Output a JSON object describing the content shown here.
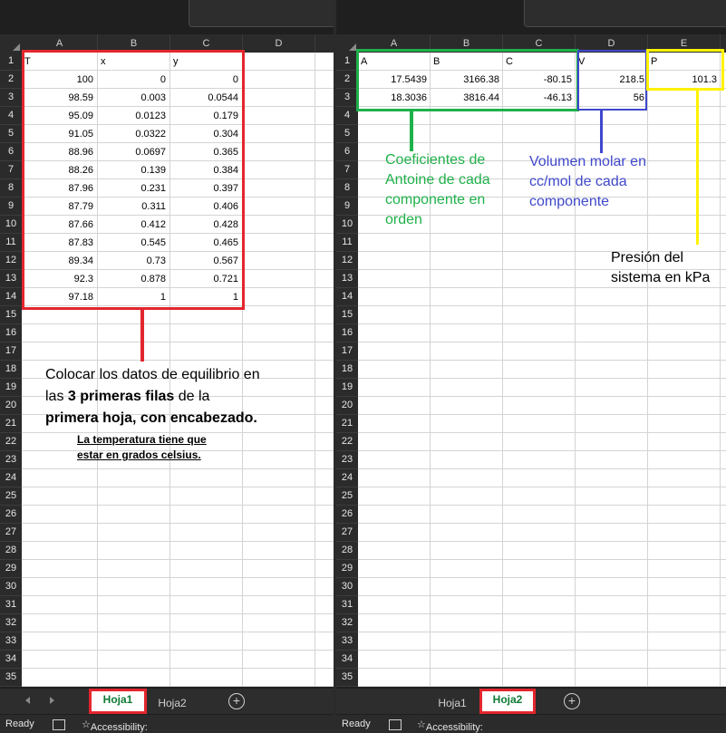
{
  "left": {
    "columns": [
      "A",
      "B",
      "C",
      "D"
    ],
    "rows": [
      "1",
      "2",
      "3",
      "4",
      "5",
      "6",
      "7",
      "8",
      "9",
      "10",
      "11",
      "12",
      "13",
      "14",
      "15",
      "16",
      "17",
      "18",
      "19",
      "20",
      "21",
      "22",
      "23",
      "24",
      "25",
      "26",
      "27",
      "28",
      "29",
      "30",
      "31",
      "32",
      "33",
      "34",
      "35"
    ],
    "headers": {
      "T": "T",
      "x": "x",
      "y": "y"
    },
    "data": [
      [
        "100",
        "0",
        "0"
      ],
      [
        "98.59",
        "0.003",
        "0.0544"
      ],
      [
        "95.09",
        "0.0123",
        "0.179"
      ],
      [
        "91.05",
        "0.0322",
        "0.304"
      ],
      [
        "88.96",
        "0.0697",
        "0.365"
      ],
      [
        "88.26",
        "0.139",
        "0.384"
      ],
      [
        "87.96",
        "0.231",
        "0.397"
      ],
      [
        "87.79",
        "0.311",
        "0.406"
      ],
      [
        "87.66",
        "0.412",
        "0.428"
      ],
      [
        "87.83",
        "0.545",
        "0.465"
      ],
      [
        "89.34",
        "0.73",
        "0.567"
      ],
      [
        "92.3",
        "0.878",
        "0.721"
      ],
      [
        "97.18",
        "1",
        "1"
      ]
    ],
    "annotation": {
      "line1": "Colocar los datos de equilibrio en",
      "line2_a": "las ",
      "line2_b": "3 primeras filas",
      "line2_c": " de la",
      "line3": "primera hoja, con encabezado.",
      "note1": "La temperatura tiene que",
      "note2": "estar en grados celsius."
    },
    "tabs": {
      "sheet1": "Hoja1",
      "sheet2": "Hoja2"
    },
    "status": {
      "ready": "Ready",
      "accessibility": "Accessibility: Good to go"
    }
  },
  "right": {
    "columns": [
      "A",
      "B",
      "C",
      "D",
      "E"
    ],
    "rows": [
      "1",
      "2",
      "3",
      "4",
      "5",
      "6",
      "7",
      "8",
      "9",
      "10",
      "11",
      "12",
      "13",
      "14",
      "15",
      "16",
      "17",
      "18",
      "19",
      "20",
      "21",
      "22",
      "23",
      "24",
      "25",
      "26",
      "27",
      "28",
      "29",
      "30",
      "31",
      "32",
      "33",
      "34",
      "35"
    ],
    "headers": {
      "A": "A",
      "B": "B",
      "C": "C",
      "V": "V",
      "P": "P"
    },
    "antoine": [
      [
        "17.5439",
        "3166.38",
        "-80.15"
      ],
      [
        "18.3036",
        "3816.44",
        "-46.13"
      ]
    ],
    "volumes": [
      "218.5",
      "56"
    ],
    "pressure": "101.3",
    "annotations": {
      "green": [
        "Coeficientes de",
        "Antoine de cada",
        "componente en",
        "orden"
      ],
      "blue": [
        "Volumen molar en",
        "cc/mol de cada",
        "componente"
      ],
      "yellow": [
        "Presión del",
        "sistema en kPa"
      ]
    },
    "tabs": {
      "sheet1": "Hoja1",
      "sheet2": "Hoja2"
    },
    "status": {
      "ready": "Ready",
      "accessibility": "Accessibility: Good to go"
    }
  },
  "colors": {
    "red": "#e3262e",
    "green": "#1fb14a",
    "blue": "#3f48cc",
    "yellow": "#fff200",
    "tab_text": "#0e7a34"
  }
}
